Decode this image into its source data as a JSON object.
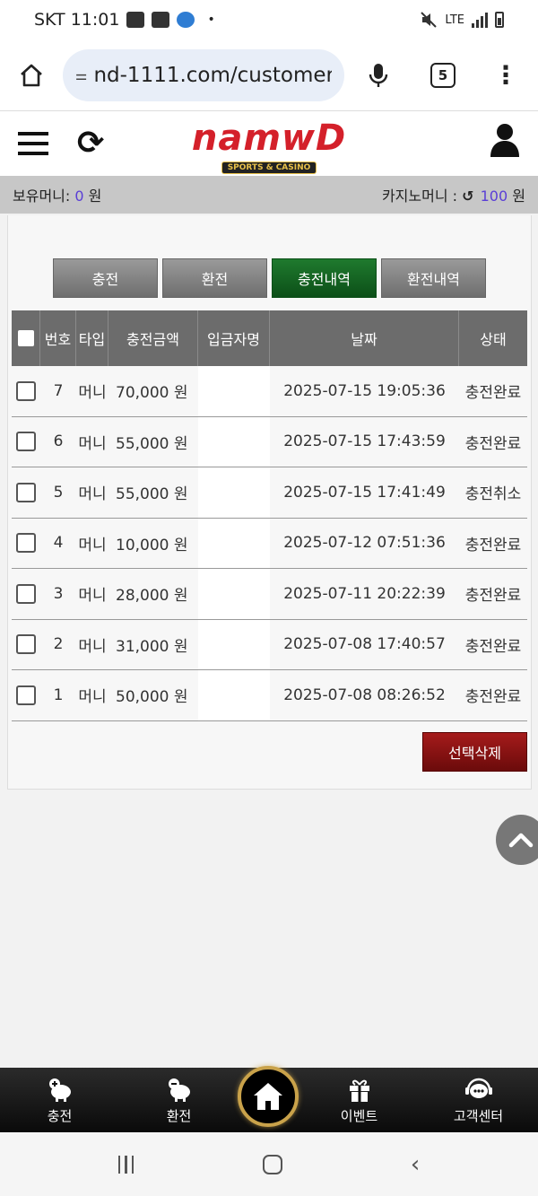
{
  "status_bar": {
    "carrier_time": "SKT 11:01",
    "network": "LTE"
  },
  "browser": {
    "url": "nd-1111.com/customer",
    "tab_count": "5"
  },
  "site": {
    "logo_text": "namwD",
    "logo_sub": "SPORTS & CASINO"
  },
  "money_bar": {
    "balance_label": "보유머니:",
    "balance_value": "0",
    "balance_unit": "원",
    "casino_label": "카지노머니 :",
    "casino_value": "100",
    "casino_unit": "원"
  },
  "tabs": [
    {
      "label": "충전",
      "active": false
    },
    {
      "label": "환전",
      "active": false
    },
    {
      "label": "충전내역",
      "active": true
    },
    {
      "label": "환전내역",
      "active": false
    }
  ],
  "table": {
    "headers": {
      "no": "번호",
      "type": "타입",
      "amount": "충전금액",
      "depositor": "입금자명",
      "date": "날짜",
      "status": "상태"
    },
    "rows": [
      {
        "no": "7",
        "type": "머니",
        "amount": "70,000 원",
        "depositor": "",
        "date": "2025-07-15 19:05:36",
        "status": "충전완료"
      },
      {
        "no": "6",
        "type": "머니",
        "amount": "55,000 원",
        "depositor": "",
        "date": "2025-07-15 17:43:59",
        "status": "충전완료"
      },
      {
        "no": "5",
        "type": "머니",
        "amount": "55,000 원",
        "depositor": "",
        "date": "2025-07-15 17:41:49",
        "status": "충전취소"
      },
      {
        "no": "4",
        "type": "머니",
        "amount": "10,000 원",
        "depositor": "",
        "date": "2025-07-12 07:51:36",
        "status": "충전완료"
      },
      {
        "no": "3",
        "type": "머니",
        "amount": "28,000 원",
        "depositor": "",
        "date": "2025-07-11 20:22:39",
        "status": "충전완료"
      },
      {
        "no": "2",
        "type": "머니",
        "amount": "31,000 원",
        "depositor": "",
        "date": "2025-07-08 17:40:57",
        "status": "충전완료"
      },
      {
        "no": "1",
        "type": "머니",
        "amount": "50,000 원",
        "depositor": "",
        "date": "2025-07-08 08:26:52",
        "status": "충전완료"
      }
    ]
  },
  "delete_button": "선택삭제",
  "bottom_nav": {
    "deposit": "충전",
    "withdraw": "환전",
    "event": "이벤트",
    "support": "고객센터"
  },
  "colors": {
    "active_tab": "#0c4f18",
    "delete_button": "#8b1010",
    "money_value": "#5a3ed6",
    "logo": "#d4202a"
  }
}
